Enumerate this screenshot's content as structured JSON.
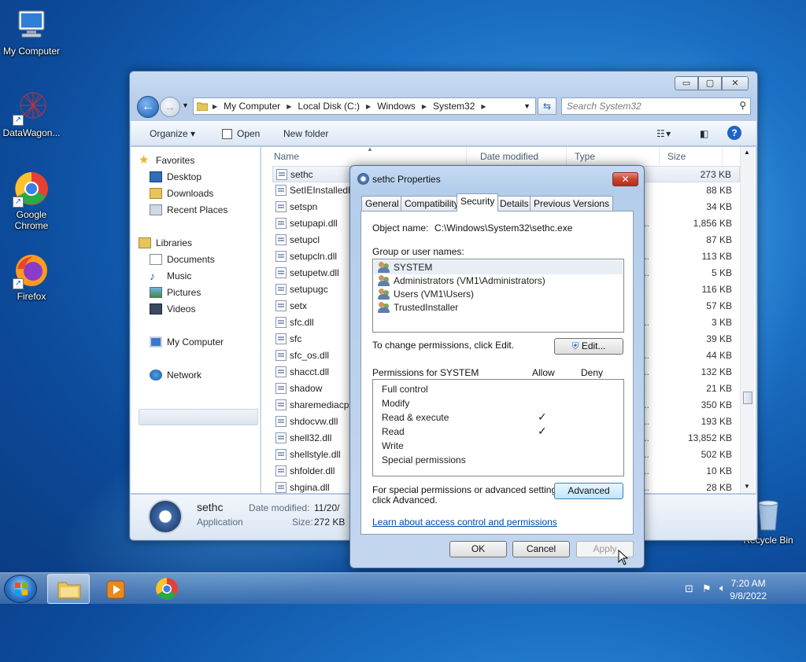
{
  "desktop": {
    "icons": [
      {
        "label": "My Computer"
      },
      {
        "label": "DataWagon..."
      },
      {
        "label": "Google Chrome"
      },
      {
        "label": "Firefox"
      },
      {
        "label": "Recycle Bin"
      }
    ]
  },
  "explorer": {
    "breadcrumb": [
      "My Computer",
      "Local Disk (C:)",
      "Windows",
      "System32"
    ],
    "search_placeholder": "Search System32",
    "commands": {
      "organize": "Organize",
      "open": "Open",
      "new_folder": "New folder"
    },
    "nav": {
      "favorites": "Favorites",
      "desktop": "Desktop",
      "downloads": "Downloads",
      "recent": "Recent Places",
      "libraries": "Libraries",
      "documents": "Documents",
      "music": "Music",
      "pictures": "Pictures",
      "videos": "Videos",
      "computer": "My Computer",
      "network": "Network"
    },
    "columns": {
      "name": "Name",
      "date": "Date modified",
      "type": "Type",
      "size": "Size"
    },
    "files": [
      {
        "name": "sethc",
        "type": "",
        "size": "273 KB"
      },
      {
        "name": "SetIEInstalledD",
        "type": "",
        "size": "88 KB"
      },
      {
        "name": "setspn",
        "type": "",
        "size": "34 KB"
      },
      {
        "name": "setupapi.dll",
        "type": "s...",
        "size": "1,856 KB"
      },
      {
        "name": "setupcl",
        "type": "",
        "size": "87 KB"
      },
      {
        "name": "setupcln.dll",
        "type": "s...",
        "size": "113 KB"
      },
      {
        "name": "setupetw.dll",
        "type": "s...",
        "size": "5 KB"
      },
      {
        "name": "setupugc",
        "type": "",
        "size": "116 KB"
      },
      {
        "name": "setx",
        "type": "",
        "size": "57 KB"
      },
      {
        "name": "sfc.dll",
        "type": "s...",
        "size": "3 KB"
      },
      {
        "name": "sfc",
        "type": "",
        "size": "39 KB"
      },
      {
        "name": "sfc_os.dll",
        "type": "s...",
        "size": "44 KB"
      },
      {
        "name": "shacct.dll",
        "type": "s...",
        "size": "132 KB"
      },
      {
        "name": "shadow",
        "type": "",
        "size": "21 KB"
      },
      {
        "name": "sharemediacp",
        "type": "s...",
        "size": "350 KB"
      },
      {
        "name": "shdocvw.dll",
        "type": "s...",
        "size": "193 KB"
      },
      {
        "name": "shell32.dll",
        "type": "s...",
        "size": "13,852 KB"
      },
      {
        "name": "shellstyle.dll",
        "type": "s...",
        "size": "502 KB"
      },
      {
        "name": "shfolder.dll",
        "type": "s...",
        "size": "10 KB"
      },
      {
        "name": "shgina.dll",
        "type": "s...",
        "size": "28 KB"
      }
    ],
    "details": {
      "name": "sethc",
      "kind": "Application",
      "date_label": "Date modified:",
      "date_value": "11/20/",
      "size_label": "Size:",
      "size_value": "272 KB"
    }
  },
  "dialog": {
    "title": "sethc Properties",
    "close_glyph": "✕",
    "tabs": [
      "General",
      "Compatibility",
      "Security",
      "Details",
      "Previous Versions"
    ],
    "object_label": "Object name:",
    "object_value": "C:\\Windows\\System32\\sethc.exe",
    "group_label": "Group or user names:",
    "users": [
      "SYSTEM",
      "Administrators (VM1\\Administrators)",
      "Users (VM1\\Users)",
      "TrustedInstaller"
    ],
    "change_text": "To change permissions, click Edit.",
    "edit_button": "Edit...",
    "perm_header": "Permissions for SYSTEM",
    "allow_header": "Allow",
    "deny_header": "Deny",
    "permissions": [
      {
        "name": "Full control",
        "allow": ""
      },
      {
        "name": "Modify",
        "allow": ""
      },
      {
        "name": "Read & execute",
        "allow": "✓"
      },
      {
        "name": "Read",
        "allow": "✓"
      },
      {
        "name": "Write",
        "allow": ""
      },
      {
        "name": "Special permissions",
        "allow": ""
      }
    ],
    "advanced_text_1": "For special permissions or advanced settings,",
    "advanced_text_2": "click Advanced.",
    "advanced_button": "Advanced",
    "learn_link": "Learn about access control and permissions",
    "ok": "OK",
    "cancel": "Cancel",
    "apply": "Apply"
  },
  "taskbar": {
    "time": "7:20 AM",
    "date": "9/8/2022"
  }
}
